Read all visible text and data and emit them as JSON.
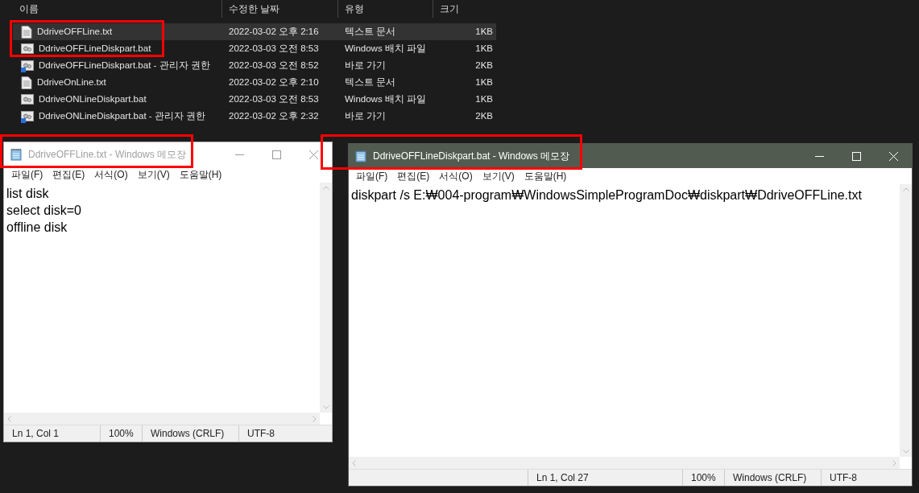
{
  "explorer": {
    "columns": [
      "이름",
      "수정한 날짜",
      "유형",
      "크기"
    ],
    "rows": [
      {
        "name": "DdriveOFFLine.txt",
        "modified": "2022-03-02 오후 2:16",
        "type": "텍스트 문서",
        "size": "1KB",
        "kind": "text",
        "selected": true
      },
      {
        "name": "DdriveOFFLineDiskpart.bat",
        "modified": "2022-03-03 오전 8:53",
        "type": "Windows 배치 파일",
        "size": "1KB",
        "kind": "batch",
        "selected": false
      },
      {
        "name": "DdriveOFFLineDiskpart.bat - 관리자 권한",
        "modified": "2022-03-03 오전 8:52",
        "type": "바로 가기",
        "size": "2KB",
        "kind": "shortcut",
        "selected": false
      },
      {
        "name": "DdriveOnLine.txt",
        "modified": "2022-03-02 오후 2:10",
        "type": "텍스트 문서",
        "size": "1KB",
        "kind": "text",
        "selected": false
      },
      {
        "name": "DdriveONLineDiskpart.bat",
        "modified": "2022-03-03 오전 8:53",
        "type": "Windows 배치 파일",
        "size": "1KB",
        "kind": "batch",
        "selected": false
      },
      {
        "name": "DdriveONLineDiskpart.bat - 관리자 권한",
        "modified": "2022-03-02 오후 2:32",
        "type": "바로 가기",
        "size": "2KB",
        "kind": "shortcut",
        "selected": false
      }
    ]
  },
  "windows": [
    {
      "title": "DdriveOFFLine.txt - Windows 메모장",
      "active": false,
      "menu": [
        "파일(F)",
        "편집(E)",
        "서식(O)",
        "보기(V)",
        "도움말(H)"
      ],
      "lines": [
        "list disk",
        "select disk=0",
        "offline disk"
      ],
      "status": [
        "Ln 1, Col 1",
        "100%",
        "Windows (CRLF)",
        "UTF-8"
      ]
    },
    {
      "title": "DdriveOFFLineDiskpart.bat - Windows 메모장",
      "active": true,
      "menu": [
        "파일(F)",
        "편집(E)",
        "서식(O)",
        "보기(V)",
        "도움말(H)"
      ],
      "lines": [
        "diskpart /s E:₩004-program₩WindowsSimpleProgramDoc₩diskpart₩DdriveOFFLine.txt"
      ],
      "status": [
        "Ln 1, Col 27",
        "100%",
        "Windows (CRLF)",
        "UTF-8"
      ]
    }
  ]
}
